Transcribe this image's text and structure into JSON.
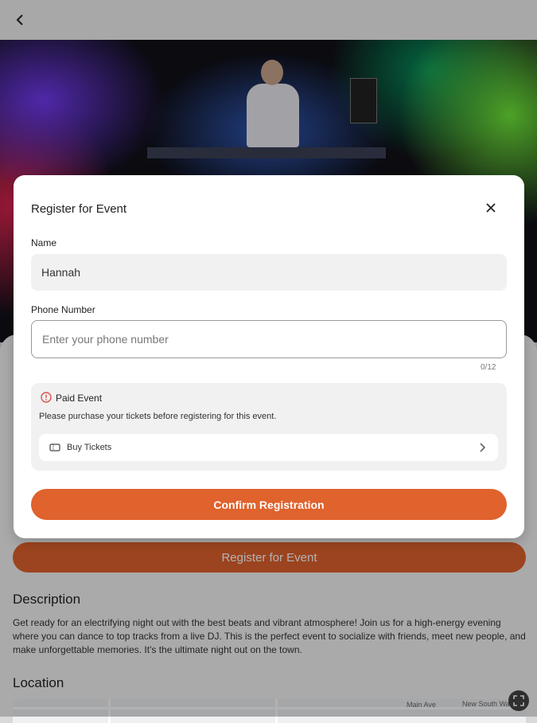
{
  "page": {
    "register_button_label": "Register for Event",
    "description_title": "Description",
    "description_text": "Get ready for an electrifying night out with the best beats and vibrant atmosphere! Join us for a high-energy evening where you can dance to top tracks from a live DJ. This is the perfect event to socialize with friends, meet new people, and make unforgettable memories. It's the ultimate night out on the town.",
    "location_title": "Location",
    "map_labels": [
      "New South Wales",
      "Main Ave"
    ]
  },
  "modal": {
    "title": "Register for Event",
    "name_label": "Name",
    "name_value": "Hannah",
    "phone_label": "Phone Number",
    "phone_placeholder": "Enter your phone number",
    "phone_counter": "0/12",
    "paid_title": "Paid Event",
    "paid_desc": "Please purchase your tickets before registering for this event.",
    "buy_label": "Buy Tickets",
    "confirm_label": "Confirm Registration"
  },
  "colors": {
    "accent": "#e0622d",
    "field_bg": "#f1f1f1",
    "warning_icon": "#d9534f"
  },
  "icons": {
    "back": "back-arrow-icon",
    "close": "close-icon",
    "paid": "alert-circle-icon",
    "ticket": "ticket-icon",
    "chevron": "chevron-right-icon",
    "fullscreen": "fullscreen-icon"
  }
}
